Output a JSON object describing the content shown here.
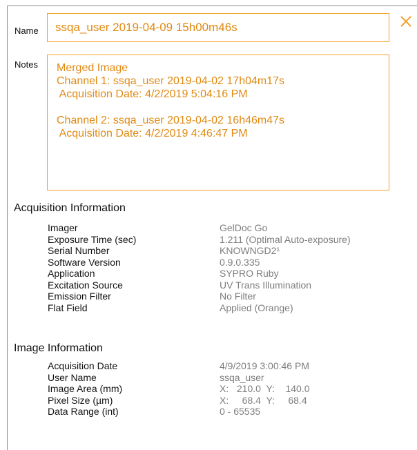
{
  "name_label": "Name",
  "name_value": "ssqa_user 2019-04-09 15h00m46s",
  "notes_label": "Notes",
  "notes_lines": [
    "Merged Image",
    "Channel 1: ssqa_user 2019-04-02 17h04m17s",
    " Acquisition Date: 4/2/2019 5:04:16 PM",
    "",
    "Channel 2: ssqa_user 2019-04-02 16h46m47s",
    " Acquisition Date: 4/2/2019 4:46:47 PM"
  ],
  "close_icon": "close-x-icon",
  "accent_color": "#f0a02a",
  "acquisition": {
    "title": "Acquisition Information",
    "rows": [
      {
        "label": "Imager",
        "value": "GelDoc Go"
      },
      {
        "label": "Exposure Time (sec)",
        "value": "1.211 (Optimal Auto-exposure)"
      },
      {
        "label": "Serial Number",
        "value": "KNOWNGD2¹"
      },
      {
        "label": "Software Version",
        "value": "0.9.0.335"
      },
      {
        "label": "Application",
        "value": "SYPRO Ruby"
      },
      {
        "label": "Excitation Source",
        "value": "UV Trans Illumination"
      },
      {
        "label": "Emission Filter",
        "value": "No Filter"
      },
      {
        "label": "Flat Field",
        "value": "Applied (Orange)"
      }
    ]
  },
  "image_info": {
    "title": "Image Information",
    "rows": [
      {
        "label": "Acquisition Date",
        "value": "4/9/2019 3:00:46 PM"
      },
      {
        "label": "User Name",
        "value": "ssqa_user"
      },
      {
        "label": "Image Area (mm)",
        "value": "X:   210.0  Y:    140.0"
      },
      {
        "label": "Pixel Size (µm)",
        "value": "X:     68.4  Y:     68.4"
      },
      {
        "label": "Data Range (int)",
        "value": "0 - 65535"
      }
    ]
  }
}
